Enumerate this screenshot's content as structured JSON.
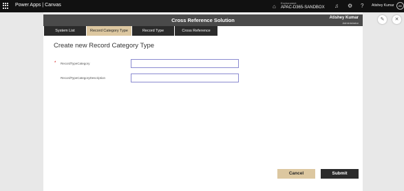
{
  "topbar": {
    "app_name": "Power Apps  |  Canvas",
    "environment_label": "Environment",
    "environment_name": "APAC-D365-SANDBOX",
    "user_name": "Atishey Kumar",
    "avatar_initials": "AK",
    "icons": [
      "waffle-icon",
      "environment-icon",
      "bell-icon",
      "settings-icon",
      "help-icon"
    ]
  },
  "app": {
    "title": "Cross Reference Solution",
    "user_name": "Atishey Kumar",
    "user_role": "Administrator",
    "tabs": [
      {
        "label": "System List",
        "active": false
      },
      {
        "label": "Record Category Type",
        "active": true
      },
      {
        "label": "Record Type",
        "active": false
      },
      {
        "label": "Cross Reference",
        "active": false
      }
    ],
    "form_title": "Create new Record Category Type",
    "required_marker": "*",
    "fields": [
      {
        "label": "RecordTypeCategory",
        "value": "",
        "required": true
      },
      {
        "label": "RecordTypeCategoryDescription",
        "value": "",
        "required": false
      }
    ],
    "cancel_label": "Cancel",
    "submit_label": "Submit"
  },
  "colors": {
    "topbar_bg": "#111111",
    "header_bg": "#4a4a4a",
    "tab_bg": "#2b2b2b",
    "tab_active_bg": "#dcc7a0",
    "cancel_bg": "#dcc7a0",
    "submit_bg": "#2b2b2b",
    "input_border": "#8a8ad0"
  },
  "side_icons": [
    "edit-icon",
    "close-icon"
  ]
}
